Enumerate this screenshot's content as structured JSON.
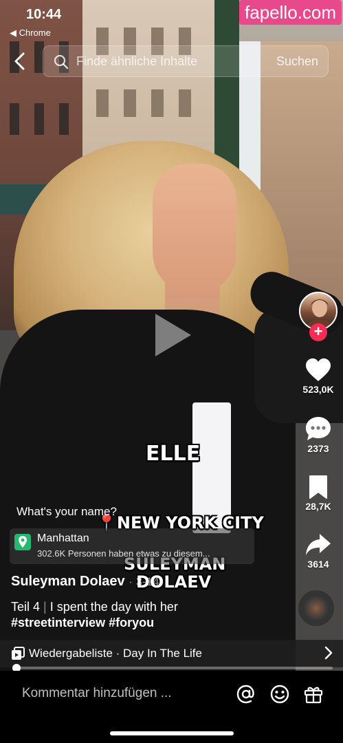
{
  "status": {
    "time": "10:44",
    "back_app": "◀ Chrome"
  },
  "watermark": "fapello.com",
  "search": {
    "placeholder": "Finde ähnliche Inhalte",
    "button": "Suchen"
  },
  "rail": {
    "likes": "523,0K",
    "comments": "2373",
    "saves": "28,7K",
    "shares": "3614"
  },
  "captions": {
    "name": "ELLE",
    "city": "📍NEW YORK CITY",
    "interviewer_1": "SULEYMAN",
    "interviewer_2": "DOLAEV"
  },
  "question": "What's your name?",
  "location": {
    "title": "Manhattan",
    "subtitle": "302.6K Personen haben etwas zu diesem..."
  },
  "post": {
    "username": "Suleyman Dolaev",
    "date": "· 3-14",
    "part": "Teil 4",
    "text": "I spent the day with her",
    "hashtags": "#streetinterview #foryou"
  },
  "playlist": {
    "label": "Wiedergabeliste · Day In The Life"
  },
  "progress": {
    "fraction": 0.01
  },
  "bottom": {
    "comment_placeholder": "Kommentar hinzufügen ..."
  },
  "colors": {
    "accent": "#fe2c55",
    "location": "#25b870",
    "watermark": "#e8498c"
  }
}
